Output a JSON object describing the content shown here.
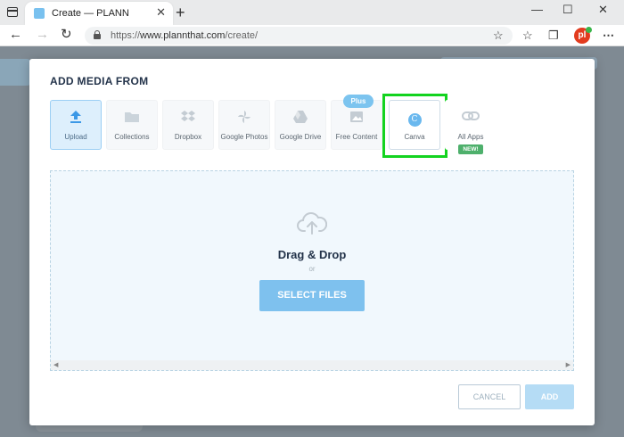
{
  "browser": {
    "tab_title": "Create — PLANN",
    "tab_close": "✕",
    "new_tab": "+",
    "win_min": "—",
    "win_max": "☐",
    "win_close": "✕",
    "nav_back": "←",
    "nav_forward": "→",
    "nav_refresh": "↻",
    "url_prefix": "https://",
    "url_host": "www.plannthat.com",
    "url_path": "/create/",
    "profile_initials": "pl",
    "more": "⋯"
  },
  "modal": {
    "title": "ADD MEDIA FROM",
    "sources": [
      {
        "label": "Upload",
        "icon": "upload-icon"
      },
      {
        "label": "Collections",
        "icon": "folder-icon"
      },
      {
        "label": "Dropbox",
        "icon": "dropbox-icon"
      },
      {
        "label": "Google Photos",
        "icon": "google-photos-icon"
      },
      {
        "label": "Google Drive",
        "icon": "google-drive-icon"
      },
      {
        "label": "Free Content",
        "icon": "image-icon"
      },
      {
        "label": "Canva",
        "icon": "canva-icon"
      },
      {
        "label": "All Apps",
        "icon": "link-icon"
      }
    ],
    "plus_badge": "Plus",
    "new_badge": "NEW!",
    "canva_letter": "C",
    "dropzone": {
      "title": "Drag & Drop",
      "or": "or",
      "button": "SELECT FILES"
    },
    "cancel": "CANCEL",
    "add": "ADD"
  },
  "colors": {
    "accent": "#7ec1ee",
    "highlight": "#13d31f",
    "title": "#23334a",
    "new_badge": "#4eb06c"
  }
}
